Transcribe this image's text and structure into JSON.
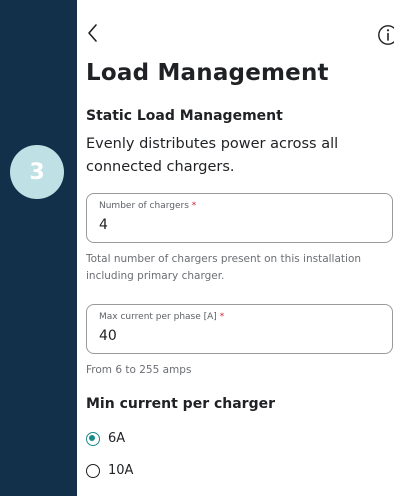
{
  "step": {
    "number": "3"
  },
  "header": {
    "title": "Load Management"
  },
  "section": {
    "title": "Static Load Management",
    "description": "Evenly distributes power across all connected chargers."
  },
  "fields": {
    "chargers": {
      "label": "Number of chargers",
      "required_mark": "*",
      "value": "4",
      "helper": "Total number of chargers present on this installation including primary charger."
    },
    "max_current": {
      "label": "Max current per phase [A]",
      "required_mark": "*",
      "value": "40",
      "helper": "From 6 to 255 amps"
    }
  },
  "min_current": {
    "title": "Min current per charger",
    "options": [
      {
        "label": "6A",
        "selected": true
      },
      {
        "label": "10A",
        "selected": false
      }
    ]
  },
  "colors": {
    "sidebar_bg": "#12304a",
    "badge_bg": "#bfe0e4",
    "accent": "#1c8a8a",
    "required": "#d0243a"
  },
  "icons": {
    "back": "chevron-left-icon",
    "info": "info-circle-icon"
  }
}
